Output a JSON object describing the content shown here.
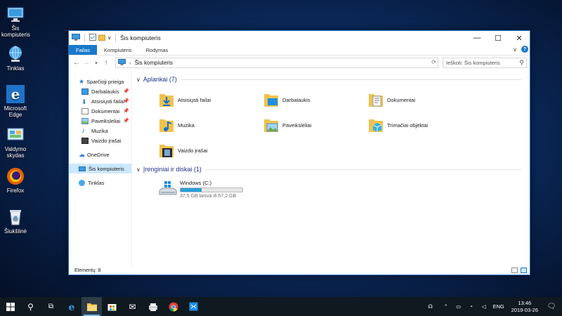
{
  "desktop": {
    "icons": [
      {
        "label_line1": "Šis",
        "label_line2": "kompiuteris"
      },
      {
        "label_line1": "Tinklas",
        "label_line2": ""
      },
      {
        "label_line1": "Microsoft",
        "label_line2": "Edge"
      },
      {
        "label_line1": "Valdymo",
        "label_line2": "skydas"
      },
      {
        "label_line1": "Firefox",
        "label_line2": ""
      },
      {
        "label_line1": "Šiukšlinė",
        "label_line2": ""
      }
    ]
  },
  "window": {
    "quick_access_dropdown": "∨",
    "title": "Šis kompiuteris",
    "controls": {
      "minimize": "—",
      "maximize": "☐",
      "close": "✕"
    },
    "ribbon_tabs": [
      {
        "label": "Failas",
        "active": true
      },
      {
        "label": "Kompiuteris",
        "active": false
      },
      {
        "label": "Rodymas",
        "active": false
      }
    ],
    "ribbon_expand": "∨",
    "help": "?",
    "address": {
      "path": "Šis kompiuteris",
      "separator": "›"
    },
    "search": {
      "placeholder": "Ieškoti: Šis kompiuteris"
    },
    "nav_pane": {
      "quick_access": "Sparčioji prieiga",
      "quick_items": [
        {
          "label": "Darbalaukis",
          "pinned": true
        },
        {
          "label": "Atsisiųsti failai",
          "pinned": true
        },
        {
          "label": "Dokumentai",
          "pinned": true
        },
        {
          "label": "Paveikslėliai",
          "pinned": true
        },
        {
          "label": "Muzika",
          "pinned": false
        },
        {
          "label": "Vaizdo įrašai",
          "pinned": false
        }
      ],
      "onedrive": "OneDrive",
      "this_pc": "Šis kompiuteris",
      "network": "Tinklas"
    },
    "folders_group": {
      "title": "Aplankai (7)",
      "items": [
        "Atsisiųsti failai",
        "Darbalaukis",
        "Dokumentai",
        "Muzika",
        "Paveikslėliai",
        "Trimačiai objektai",
        "Vaizdo įrašai"
      ]
    },
    "devices_group": {
      "title": "Įrenginiai ir diskai (1)",
      "drives": [
        {
          "name": "Windows (C:)",
          "size_text": "37,5 GB laisva iš 57,2 GB",
          "used_fraction": 0.34
        }
      ]
    },
    "status": "Elementų: 8"
  },
  "taskbar": {
    "tray": {
      "lang": "ENG",
      "time": "13:46",
      "date": "2019-03-26"
    }
  },
  "colors": {
    "accent": "#1979ca",
    "drive_bar": "#26a0da",
    "folder": "#f0c34e"
  }
}
